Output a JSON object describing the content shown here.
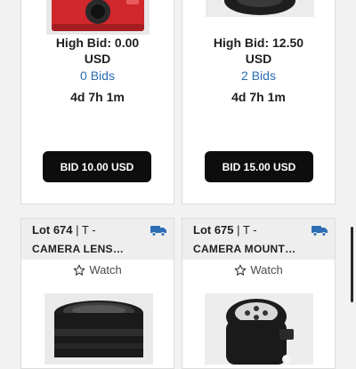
{
  "cards_top": [
    {
      "high_bid_line1": "High Bid: 0.00",
      "high_bid_line2": "USD",
      "bids": "0 Bids",
      "time_left": "4d 7h 1m",
      "bid_button": "BID 10.00 USD"
    },
    {
      "high_bid_line1": "High Bid: 12.50",
      "high_bid_line2": "USD",
      "bids": "2 Bids",
      "time_left": "4d 7h 1m",
      "bid_button": "BID 15.00 USD"
    }
  ],
  "cards_bottom": [
    {
      "lot_label": "Lot 674",
      "lot_sep": "| T -",
      "title": "CAMERA LENS…",
      "watch": "Watch",
      "shipping_icon": "truck-icon",
      "image_subject": "camera-lens"
    },
    {
      "lot_label": "Lot 675",
      "lot_sep": "| T -",
      "title": "CAMERA MOUNT…",
      "watch": "Watch",
      "shipping_icon": "truck-icon",
      "image_subject": "camera-mount"
    }
  ],
  "colors": {
    "link": "#2b6cb0",
    "truck": "#2d6db5",
    "button": "#0d0d0d"
  }
}
